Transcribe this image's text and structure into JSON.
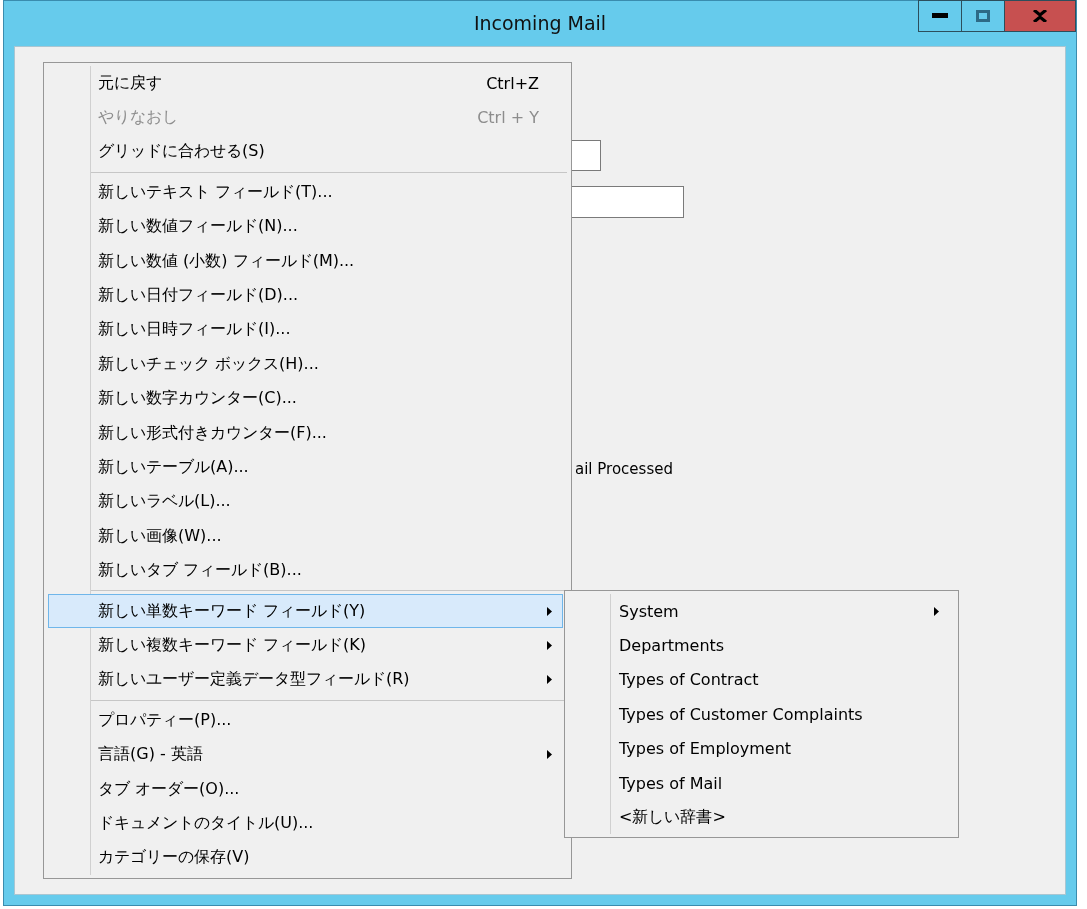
{
  "window": {
    "title": "Incoming Mail"
  },
  "form": {
    "checkbox_label": "ail Processed"
  },
  "context_menu": {
    "items": [
      {
        "kind": "item",
        "label": "元に戻す",
        "shortcut": "Ctrl+Z",
        "disabled": false,
        "selected": false,
        "submenu": false
      },
      {
        "kind": "item",
        "label": "やりなおし",
        "shortcut": "Ctrl + Y",
        "disabled": true,
        "selected": false,
        "submenu": false
      },
      {
        "kind": "item",
        "label": "グリッドに合わせる(S)",
        "disabled": false,
        "selected": false,
        "submenu": false
      },
      {
        "kind": "separator"
      },
      {
        "kind": "item",
        "label": "新しいテキスト フィールド(T)...",
        "disabled": false,
        "selected": false,
        "submenu": false
      },
      {
        "kind": "item",
        "label": "新しい数値フィールド(N)...",
        "disabled": false,
        "selected": false,
        "submenu": false
      },
      {
        "kind": "item",
        "label": "新しい数値 (小数) フィールド(M)...",
        "disabled": false,
        "selected": false,
        "submenu": false
      },
      {
        "kind": "item",
        "label": "新しい日付フィールド(D)...",
        "disabled": false,
        "selected": false,
        "submenu": false
      },
      {
        "kind": "item",
        "label": "新しい日時フィールド(I)...",
        "disabled": false,
        "selected": false,
        "submenu": false
      },
      {
        "kind": "item",
        "label": "新しいチェック ボックス(H)...",
        "disabled": false,
        "selected": false,
        "submenu": false
      },
      {
        "kind": "item",
        "label": "新しい数字カウンター(C)...",
        "disabled": false,
        "selected": false,
        "submenu": false
      },
      {
        "kind": "item",
        "label": "新しい形式付きカウンター(F)...",
        "disabled": false,
        "selected": false,
        "submenu": false
      },
      {
        "kind": "item",
        "label": "新しいテーブル(A)...",
        "disabled": false,
        "selected": false,
        "submenu": false
      },
      {
        "kind": "item",
        "label": "新しいラベル(L)...",
        "disabled": false,
        "selected": false,
        "submenu": false
      },
      {
        "kind": "item",
        "label": "新しい画像(W)...",
        "disabled": false,
        "selected": false,
        "submenu": false
      },
      {
        "kind": "item",
        "label": "新しいタブ フィールド(B)...",
        "disabled": false,
        "selected": false,
        "submenu": false
      },
      {
        "kind": "separator"
      },
      {
        "kind": "item",
        "label": "新しい単数キーワード フィールド(Y)",
        "disabled": false,
        "selected": true,
        "submenu": true
      },
      {
        "kind": "item",
        "label": "新しい複数キーワード フィールド(K)",
        "disabled": false,
        "selected": false,
        "submenu": true
      },
      {
        "kind": "item",
        "label": "新しいユーザー定義データ型フィールド(R)",
        "disabled": false,
        "selected": false,
        "submenu": true
      },
      {
        "kind": "separator"
      },
      {
        "kind": "item",
        "label": "プロパティー(P)...",
        "disabled": false,
        "selected": false,
        "submenu": false
      },
      {
        "kind": "item",
        "label": "言語(G) - 英語",
        "disabled": false,
        "selected": false,
        "submenu": true
      },
      {
        "kind": "item",
        "label": "タブ オーダー(O)...",
        "disabled": false,
        "selected": false,
        "submenu": false
      },
      {
        "kind": "item",
        "label": "ドキュメントのタイトル(U)...",
        "disabled": false,
        "selected": false,
        "submenu": false
      },
      {
        "kind": "item",
        "label": "カテゴリーの保存(V)",
        "disabled": false,
        "selected": false,
        "submenu": false
      }
    ]
  },
  "submenu": {
    "items": [
      {
        "label": "System",
        "selected": false,
        "submenu": true
      },
      {
        "label": "Departments",
        "selected": false,
        "submenu": false
      },
      {
        "label": "Types of Contract",
        "selected": false,
        "submenu": false
      },
      {
        "label": "Types of Customer Complaints",
        "selected": false,
        "submenu": false
      },
      {
        "label": "Types of Employment",
        "selected": false,
        "submenu": false
      },
      {
        "label": "Types of Mail",
        "selected": false,
        "submenu": false
      },
      {
        "label": "<新しい辞書>",
        "selected": false,
        "submenu": false
      }
    ]
  }
}
